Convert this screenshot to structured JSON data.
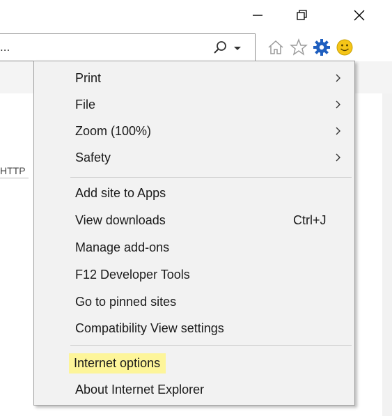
{
  "window": {
    "caption_buttons": [
      {
        "name": "minimize",
        "icon": "minimize-icon"
      },
      {
        "name": "restore",
        "icon": "restore-icon"
      },
      {
        "name": "close",
        "icon": "close-icon"
      }
    ]
  },
  "address_bar": {
    "value": "...",
    "search_icon": "search-icon",
    "dropdown_icon": "chevron-down-icon"
  },
  "toolbar": {
    "icons": [
      "home-icon",
      "favorites-star-icon",
      "tools-gear-icon",
      "feedback-smiley-icon"
    ],
    "gear_color": "#1f5fbf",
    "smiley_color": "#f5c518"
  },
  "background": {
    "tab_fragment": "HTTP"
  },
  "menu": {
    "groups": [
      [
        {
          "label": "Print",
          "submenu": true
        },
        {
          "label": "File",
          "submenu": true
        },
        {
          "label": "Zoom (100%)",
          "submenu": true
        },
        {
          "label": "Safety",
          "submenu": true
        }
      ],
      [
        {
          "label": "Add site to Apps"
        },
        {
          "label": "View downloads",
          "shortcut": "Ctrl+J"
        },
        {
          "label": "Manage add-ons"
        },
        {
          "label": "F12 Developer Tools"
        },
        {
          "label": "Go to pinned sites"
        },
        {
          "label": "Compatibility View settings"
        }
      ],
      [
        {
          "label": "Internet options",
          "highlighted": true
        },
        {
          "label": "About Internet Explorer"
        }
      ]
    ],
    "highlight_color": "#fdf59a"
  }
}
